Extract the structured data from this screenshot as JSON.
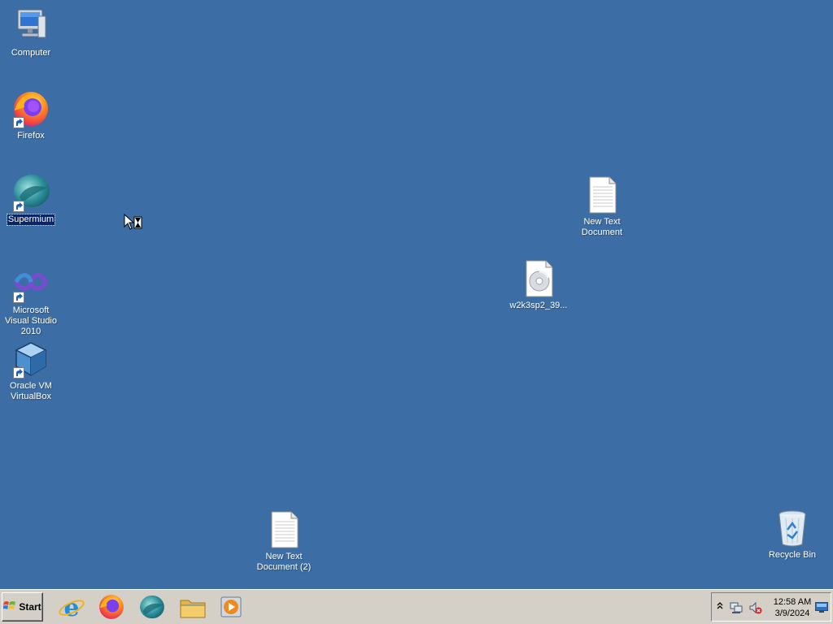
{
  "desktop": {
    "background_color": "#3c6ea5",
    "icons": [
      {
        "label": "Computer",
        "icon": "computer-icon"
      },
      {
        "label": "Firefox",
        "icon": "firefox-icon"
      },
      {
        "label": "Supermium",
        "icon": "supermium-icon",
        "selected": true
      },
      {
        "label": "Microsoft Visual Studio 2010",
        "icon": "visual-studio-icon"
      },
      {
        "label": "Oracle VM VirtualBox",
        "icon": "virtualbox-icon"
      },
      {
        "label": "New Text Document",
        "icon": "text-document-icon"
      },
      {
        "label": "w2k3sp2_39...",
        "icon": "disc-image-icon"
      },
      {
        "label": "New Text Document (2)",
        "icon": "text-document-icon"
      },
      {
        "label": "Recycle Bin",
        "icon": "recycle-bin-icon"
      }
    ]
  },
  "taskbar": {
    "start_label": "Start",
    "quick_launch": [
      "internet-explorer-icon",
      "firefox-icon",
      "supermium-icon",
      "file-explorer-icon",
      "media-player-icon"
    ],
    "tray": {
      "icons": [
        "network-icon",
        "volume-muted-icon"
      ],
      "time": "12:58 AM",
      "date": "3/9/2024"
    }
  }
}
